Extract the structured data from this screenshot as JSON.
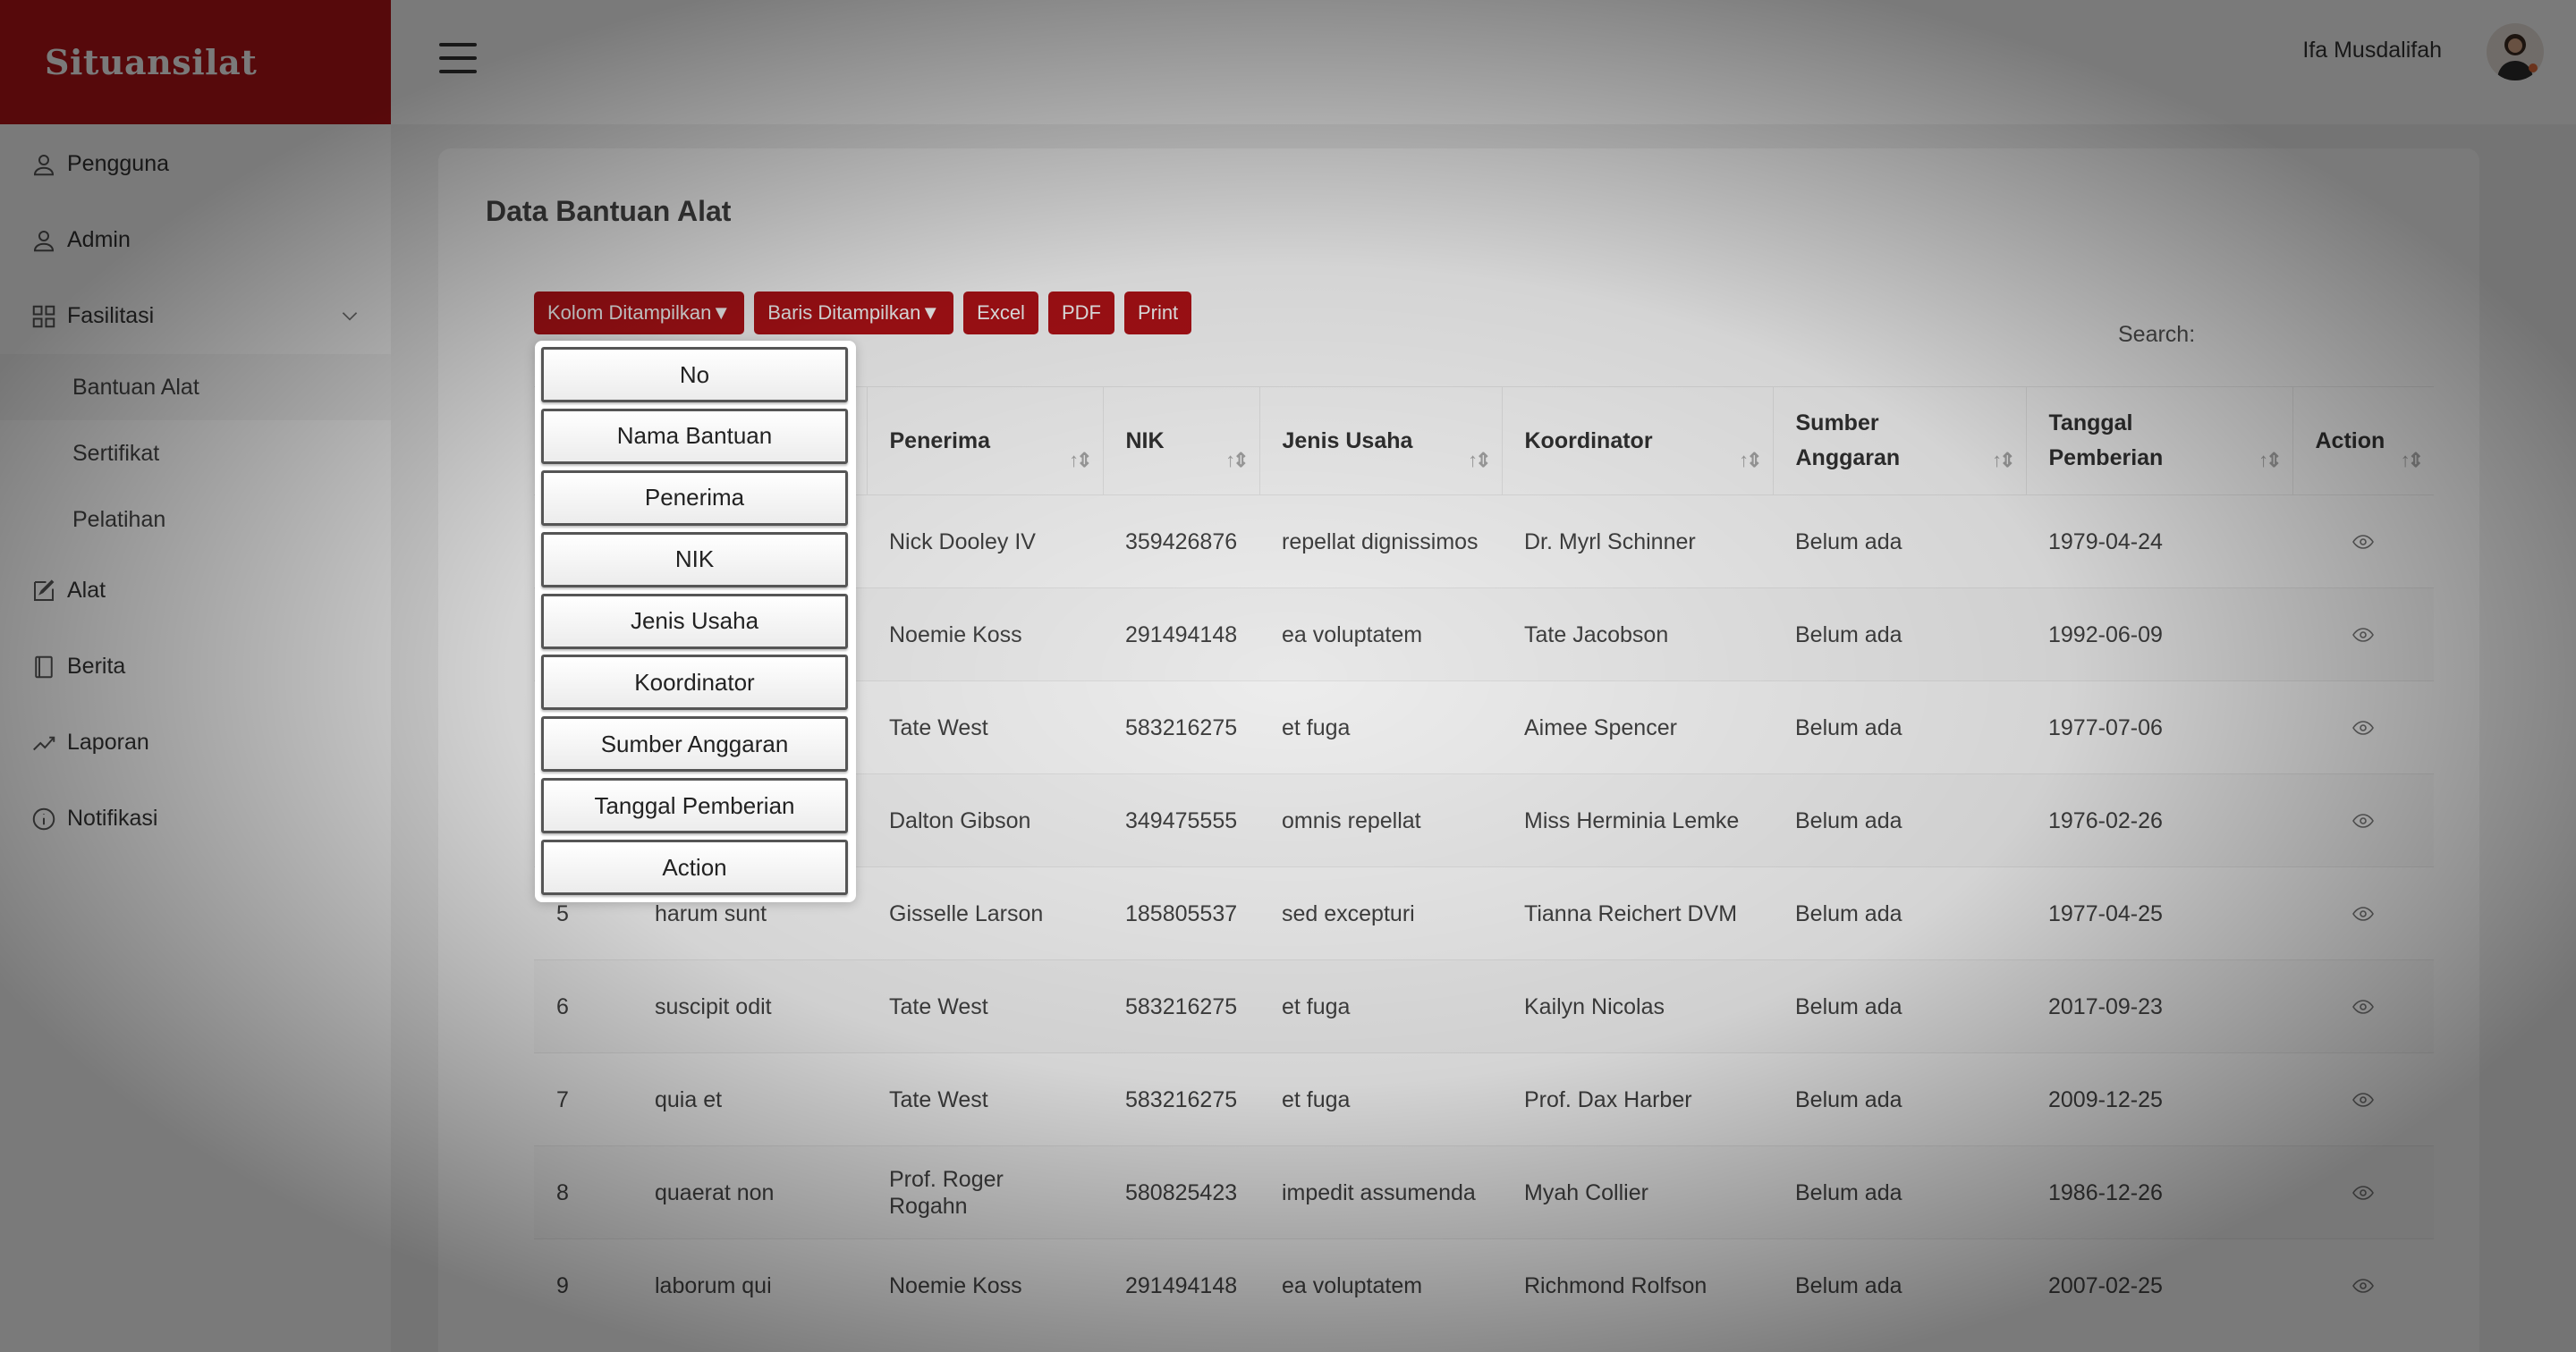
{
  "brand": "Situansilat",
  "sidebar": {
    "items": [
      {
        "label": "Pengguna",
        "icon": "user-icon"
      },
      {
        "label": "Admin",
        "icon": "user-icon"
      },
      {
        "label": "Fasilitasi",
        "icon": "grid-icon"
      },
      {
        "label": "Alat",
        "icon": "edit-icon"
      },
      {
        "label": "Berita",
        "icon": "book-icon"
      },
      {
        "label": "Laporan",
        "icon": "chart-line-icon"
      },
      {
        "label": "Notifikasi",
        "icon": "info-icon"
      }
    ],
    "subitems": [
      "Bantuan Alat",
      "Sertifikat",
      "Pelatihan"
    ]
  },
  "header": {
    "user_name": "Ifa Musdalifah"
  },
  "page": {
    "title": "Data Bantuan Alat",
    "search_label": "Search:"
  },
  "toolbar": {
    "kolom": "Kolom Ditampilkan▼",
    "baris": "Baris Ditampilkan▼",
    "excel": "Excel",
    "pdf": "PDF",
    "print": "Print"
  },
  "table": {
    "headers": [
      "Penerima",
      "NIK",
      "Jenis Usaha",
      "Koordinator",
      "Sumber Anggaran",
      "Tanggal Pemberian",
      "Action"
    ],
    "rows": [
      {
        "no": "",
        "nama": "",
        "penerima": "Nick Dooley IV",
        "nik": "359426876",
        "jenis": "repellat dignissimos",
        "koordinator": "Dr. Myrl Schinner",
        "sumber": "Belum ada",
        "tanggal": "1979-04-24"
      },
      {
        "no": "",
        "nama": "",
        "penerima": "Noemie Koss",
        "nik": "291494148",
        "jenis": "ea voluptatem",
        "koordinator": "Tate Jacobson",
        "sumber": "Belum ada",
        "tanggal": "1992-06-09"
      },
      {
        "no": "",
        "nama": "",
        "penerima": "Tate West",
        "nik": "583216275",
        "jenis": "et fuga",
        "koordinator": "Aimee Spencer",
        "sumber": "Belum ada",
        "tanggal": "1977-07-06"
      },
      {
        "no": "",
        "nama": "",
        "penerima": "Dalton Gibson",
        "nik": "349475555",
        "jenis": "omnis repellat",
        "koordinator": "Miss Herminia Lemke",
        "sumber": "Belum ada",
        "tanggal": "1976-02-26"
      },
      {
        "no": "5",
        "nama": "harum sunt",
        "penerima": "Gisselle Larson",
        "nik": "185805537",
        "jenis": "sed excepturi",
        "koordinator": "Tianna Reichert DVM",
        "sumber": "Belum ada",
        "tanggal": "1977-04-25"
      },
      {
        "no": "6",
        "nama": "suscipit odit",
        "penerima": "Tate West",
        "nik": "583216275",
        "jenis": "et fuga",
        "koordinator": "Kailyn Nicolas",
        "sumber": "Belum ada",
        "tanggal": "2017-09-23"
      },
      {
        "no": "7",
        "nama": "quia et",
        "penerima": "Tate West",
        "nik": "583216275",
        "jenis": "et fuga",
        "koordinator": "Prof. Dax Harber",
        "sumber": "Belum ada",
        "tanggal": "2009-12-25"
      },
      {
        "no": "8",
        "nama": "quaerat non",
        "penerima": "Prof. Roger Rogahn",
        "nik": "580825423",
        "jenis": "impedit assumenda",
        "koordinator": "Myah Collier",
        "sumber": "Belum ada",
        "tanggal": "1986-12-26"
      },
      {
        "no": "9",
        "nama": "laborum qui",
        "penerima": "Noemie Koss",
        "nik": "291494148",
        "jenis": "ea voluptatem",
        "koordinator": "Richmond Rolfson",
        "sumber": "Belum ada",
        "tanggal": "2007-02-25"
      }
    ]
  },
  "dropdown": {
    "options": [
      "No",
      "Nama Bantuan",
      "Penerima",
      "NIK",
      "Jenis Usaha",
      "Koordinator",
      "Sumber Anggaran",
      "Tanggal Pemberian",
      "Action"
    ]
  },
  "colors": {
    "brand": "#b31217"
  }
}
